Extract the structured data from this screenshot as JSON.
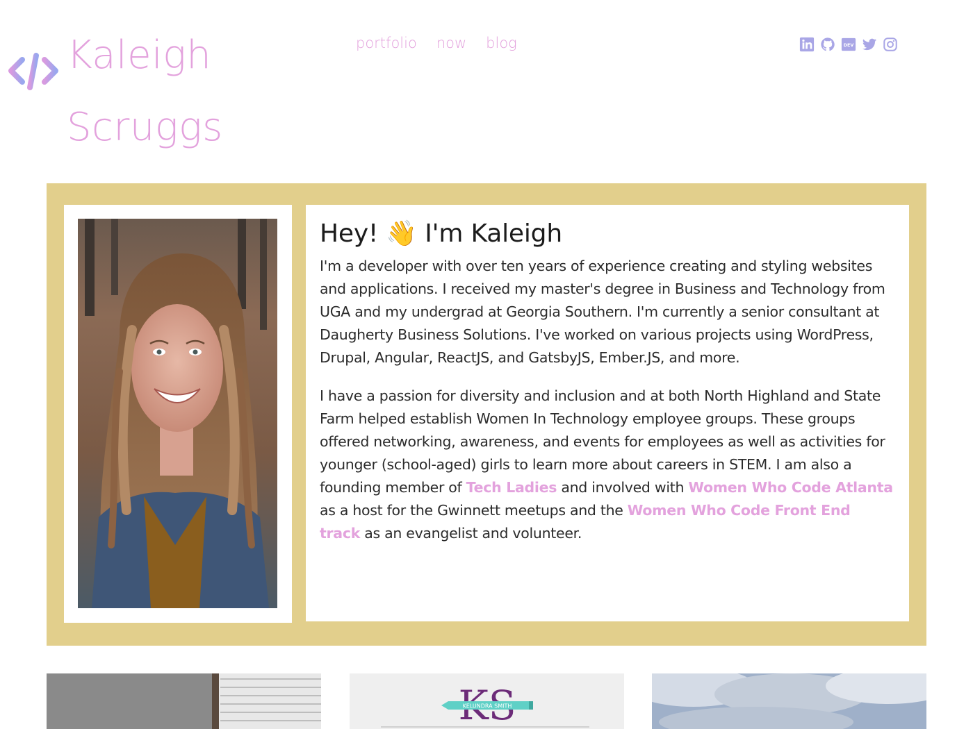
{
  "site": {
    "title_line1": "Kaleigh",
    "title_line2": "Scruggs",
    "accent_color": "#e3a2dd",
    "band_color": "#e2cf8c"
  },
  "nav": {
    "items": [
      {
        "label": "portfolio"
      },
      {
        "label": "now"
      },
      {
        "label": "blog"
      }
    ]
  },
  "social": {
    "icons": [
      "linkedin-icon",
      "github-icon",
      "dev-icon",
      "twitter-icon",
      "instagram-icon"
    ]
  },
  "about": {
    "title": "Hey! 👋 I'm Kaleigh",
    "p1": "I'm a developer with over ten years of experience creating and styling websites and applications. I received my master's degree in Business and Technology from UGA and my undergrad at Georgia Southern. I'm currently a senior consultant at Daugherty Business Solutions. I've worked on various projects using WordPress, Drupal, Angular, ReactJS, and GatsbyJS, Ember.JS, and more.",
    "p2_part1": "I have a passion for diversity and inclusion and at both North Highland and State Farm helped establish Women In Technology employee groups. These groups offered networking, awareness, and events for employees as well as activities for younger (school-aged) girls to learn more about careers in STEM. I am also a founding member of ",
    "link_tech_ladies": "Tech Ladies",
    "p2_part2": " and involved with ",
    "link_wwc_atlanta": "Women Who Code Atlanta",
    "p2_part3": " as a host for the Gwinnett meetups and the ",
    "link_wwc_frontend": "Women Who Code Front End track",
    "p2_part4": " as an evangelist and volunteer."
  },
  "portfolio": {
    "thumb2_logo_text": "KS",
    "thumb2_name": "KELUNDRA SMITH"
  }
}
